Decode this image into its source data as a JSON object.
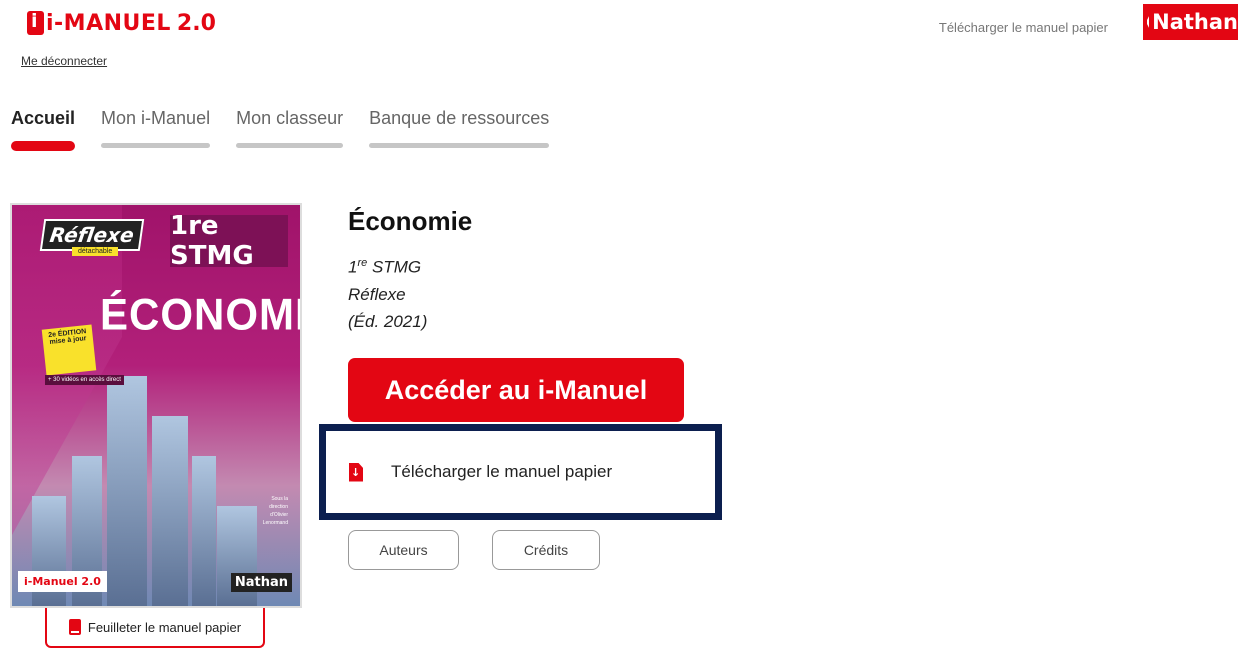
{
  "header": {
    "logo_text": "i-MANUEL",
    "logo_version": "2.0",
    "logout_label": "Me déconnecter",
    "download_link": "Télécharger le manuel papier",
    "publisher_logo": "Nathan"
  },
  "tabs": [
    {
      "label": "Accueil",
      "active": true
    },
    {
      "label": "Mon i-Manuel",
      "active": false
    },
    {
      "label": "Mon classeur",
      "active": false
    },
    {
      "label": "Banque de ressources",
      "active": false
    }
  ],
  "cover": {
    "collection": "Réflexe",
    "detachable": "détachable",
    "level": "1re STMG",
    "title": "ÉCONOMIE",
    "edition_badge": "2e ÉDITION mise à jour",
    "videos_badge": "+ 30 vidéos en accès direct",
    "authors_note": "Sous la direction d'Olivier Lenormand",
    "imanuel_badge": "i-Manuel 2.0",
    "publisher": "Nathan"
  },
  "feuilleter_label": "Feuilleter le manuel papier",
  "book": {
    "title": "Économie",
    "level_num": "1",
    "level_sup": "re",
    "level_rest": " STMG",
    "collection": "Réflexe",
    "edition": "(Éd. 2021)"
  },
  "actions": {
    "access_label": "Accéder au i-Manuel",
    "download_label": "Télécharger le manuel papier",
    "authors_label": "Auteurs",
    "credits_label": "Crédits"
  },
  "colors": {
    "brand_red": "#e30613",
    "focus_navy": "#0c1f4f"
  }
}
